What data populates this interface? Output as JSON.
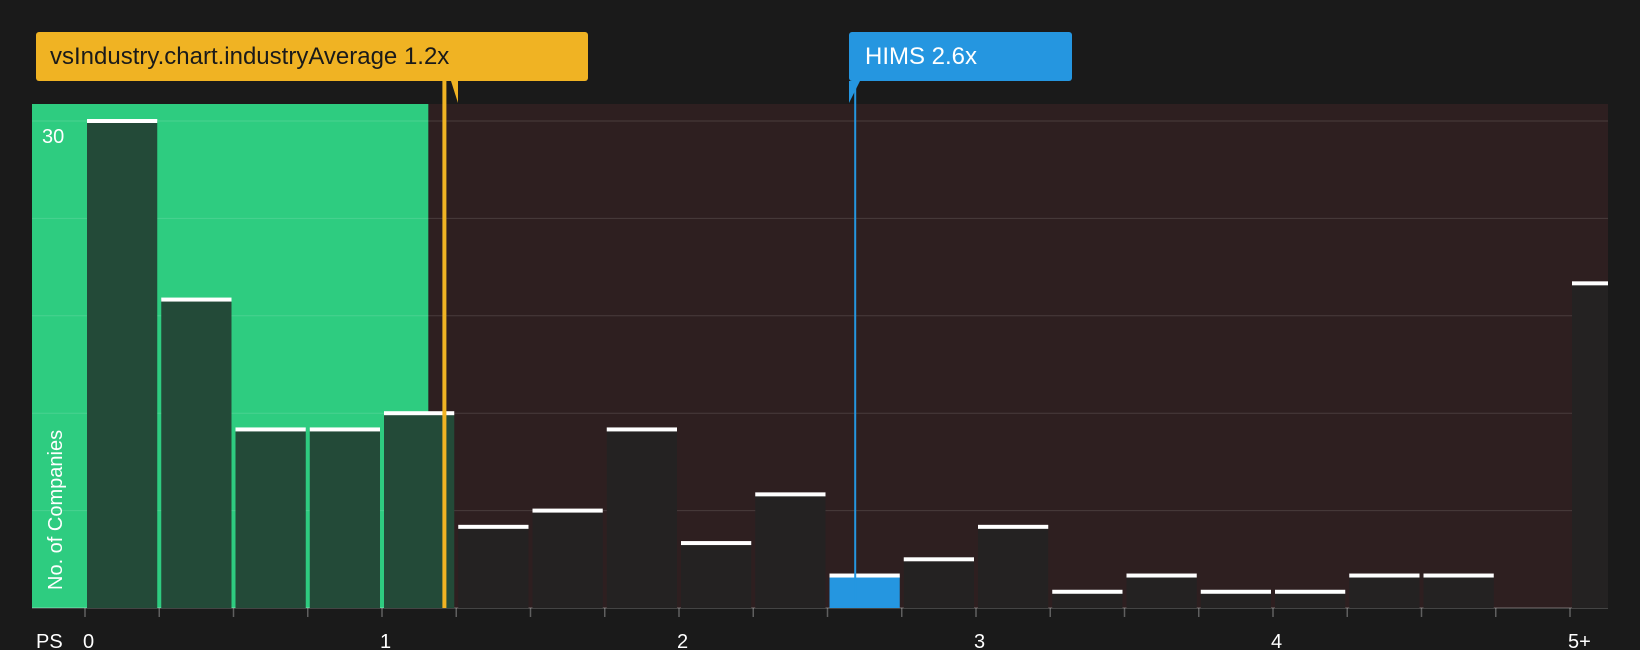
{
  "colors": {
    "background": "#1a1a1a",
    "below_region": "#2ecc80",
    "above_region": "#2e1f20",
    "industry": "#f0b323",
    "company": "#2596e0",
    "bar_default": "#242222",
    "bar_below": "#234a38",
    "cap": "#ffffff",
    "text": "#ffffff"
  },
  "callouts": {
    "industry_label": "vsIndustry.chart.industryAverage 1.2x",
    "company_label": "HIMS 2.6x"
  },
  "chart_data": {
    "type": "bar",
    "xlabel": "PS",
    "ylabel": "No. of Companies",
    "x_tick_labels": [
      "0",
      "1",
      "2",
      "3",
      "4",
      "5+"
    ],
    "y_tick_labels": [
      "30"
    ],
    "ylim": [
      0,
      31
    ],
    "xlim": [
      -0.25,
      5.12
    ],
    "grid": true,
    "industry_average": 1.2,
    "company_value": 2.6,
    "company_name": "HIMS",
    "bin_width": 0.25,
    "bins": [
      {
        "x": 0.0,
        "count": 30
      },
      {
        "x": 0.25,
        "count": 19
      },
      {
        "x": 0.5,
        "count": 11
      },
      {
        "x": 0.75,
        "count": 11
      },
      {
        "x": 1.0,
        "count": 12
      },
      {
        "x": 1.25,
        "count": 5
      },
      {
        "x": 1.5,
        "count": 6
      },
      {
        "x": 1.75,
        "count": 11
      },
      {
        "x": 2.0,
        "count": 4
      },
      {
        "x": 2.25,
        "count": 7
      },
      {
        "x": 2.5,
        "count": 2,
        "highlight": true
      },
      {
        "x": 2.75,
        "count": 3
      },
      {
        "x": 3.0,
        "count": 5
      },
      {
        "x": 3.25,
        "count": 1
      },
      {
        "x": 3.5,
        "count": 2
      },
      {
        "x": 3.75,
        "count": 1
      },
      {
        "x": 4.0,
        "count": 1
      },
      {
        "x": 4.25,
        "count": 2
      },
      {
        "x": 4.5,
        "count": 2
      },
      {
        "x": 4.75,
        "count": 0
      },
      {
        "x": 5.0,
        "count": 20
      }
    ]
  }
}
